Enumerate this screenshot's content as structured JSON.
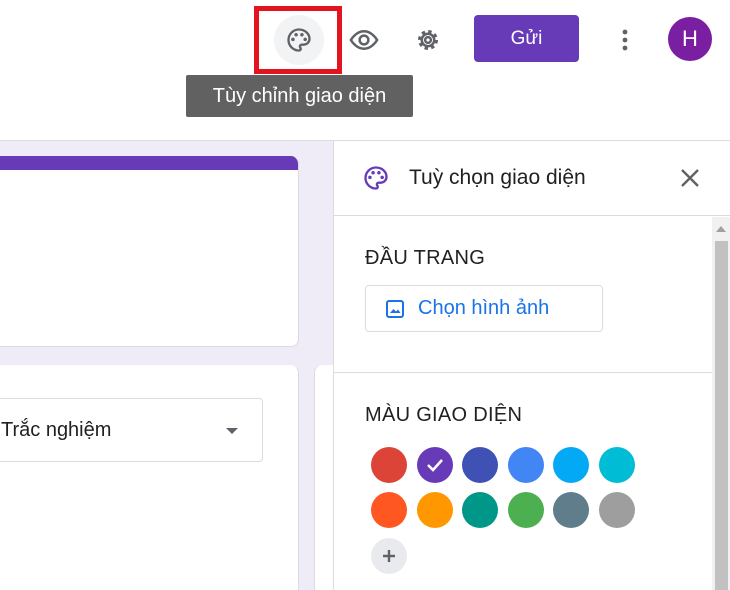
{
  "header": {
    "send_label": "Gửi",
    "avatar_letter": "H",
    "tooltip": "Tùy chỉnh giao diện",
    "accent_color": "#673ab7"
  },
  "form": {
    "question_type": "Trắc nghiệm"
  },
  "panel": {
    "title": "Tuỳ chọn giao diện",
    "header_section": "ĐẦU TRANG",
    "choose_image": "Chọn hình ảnh",
    "theme_color_section": "MÀU GIAO DIỆN",
    "colors": [
      "#db4437",
      "#673ab7",
      "#3f51b5",
      "#4285f4",
      "#03a9f4",
      "#00bcd4",
      "#ff5722",
      "#ff9800",
      "#009688",
      "#4caf50",
      "#607d8b",
      "#9e9e9e"
    ],
    "selected_color": "#673ab7"
  },
  "icons": [
    "palette-icon",
    "eye-icon",
    "gear-icon",
    "more-vert-icon",
    "close-icon",
    "image-icon",
    "check-icon",
    "plus-icon",
    "dropdown-arrow-icon"
  ]
}
